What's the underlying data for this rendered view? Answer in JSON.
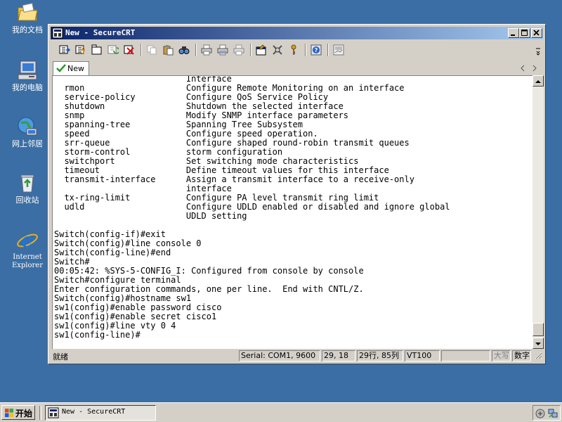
{
  "desktop": {
    "icons": [
      {
        "label": "我的文档",
        "icon": "folder-icon"
      },
      {
        "label": "我的电脑",
        "icon": "computer-icon"
      },
      {
        "label": "网上邻居",
        "icon": "network-icon"
      },
      {
        "label": "回收站",
        "icon": "recycle-bin-icon"
      },
      {
        "label_line1": "Internet",
        "label_line2": "Explorer",
        "icon": "ie-icon"
      }
    ]
  },
  "window": {
    "title": "New - SecureCRT",
    "tab_label": "New",
    "terminal_lines": [
      "                          Interface",
      "  rmon                    Configure Remote Monitoring on an interface",
      "  service-policy          Configure QoS Service Policy",
      "  shutdown                Shutdown the selected interface",
      "  snmp                    Modify SNMP interface parameters",
      "  spanning-tree           Spanning Tree Subsystem",
      "  speed                   Configure speed operation.",
      "  srr-queue               Configure shaped round-robin transmit queues",
      "  storm-control           storm configuration",
      "  switchport              Set switching mode characteristics",
      "  timeout                 Define timeout values for this interface",
      "  transmit-interface      Assign a transmit interface to a receive-only",
      "                          interface",
      "  tx-ring-limit           Configure PA level transmit ring limit",
      "  udld                    Configure UDLD enabled or disabled and ignore global",
      "                          UDLD setting",
      "",
      "Switch(config-if)#exit",
      "Switch(config)#line console 0",
      "Switch(config-line)#end",
      "Switch#",
      "00:05:42: %SYS-5-CONFIG_I: Configured from console by console",
      "Switch#configure terminal",
      "Enter configuration commands, one per line.  End with CNTL/Z.",
      "Switch(config)#hostname sw1",
      "sw1(config)#enable password cisco",
      "sw1(config)#enable secret cisco1",
      "sw1(config)#line vty 0 4",
      "sw1(config-line)#"
    ],
    "status": {
      "ready": "就绪",
      "connection": "Serial: COM1, 9600",
      "cursor": "29, 18",
      "size": "29行, 85列",
      "emulation": "VT100",
      "empty": "",
      "caps": "大写",
      "num": "数字"
    }
  },
  "taskbar": {
    "start_label": "开始",
    "task_label": "New - SecureCRT"
  },
  "colors": {
    "desktop": "#3a6ea5",
    "title_start": "#0a246a",
    "title_end": "#a6caf0",
    "chrome": "#d4d0c8"
  }
}
